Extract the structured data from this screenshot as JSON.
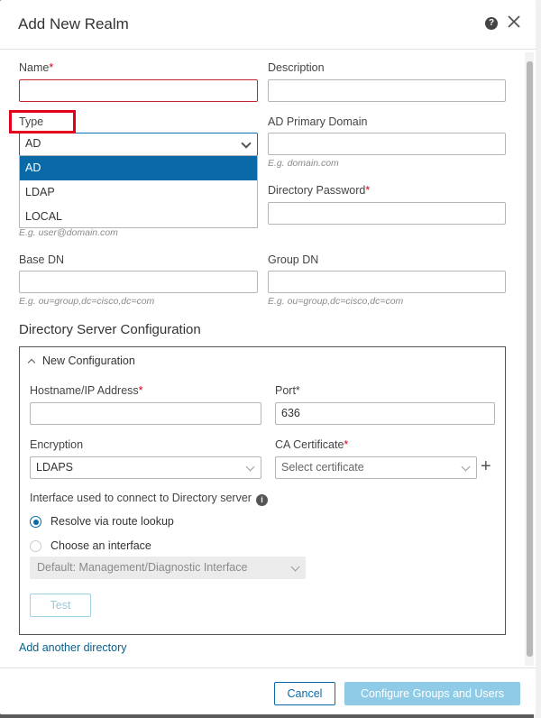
{
  "dialog": {
    "title": "Add New Realm",
    "help_icon": "?"
  },
  "fields": {
    "name_label": "Name",
    "name_required": "*",
    "name_value": "",
    "description_label": "Description",
    "description_value": "",
    "type_label": "Type",
    "type_value": "AD",
    "ad_domain_label": "AD Primary Domain",
    "ad_domain_hint": "E.g. domain.com",
    "dir_username_hint": "E.g. user@domain.com",
    "dir_password_label": "Directory Password",
    "dir_password_required": "*",
    "base_dn_label": "Base DN",
    "base_dn_hint": "E.g. ou=group,dc=cisco,dc=com",
    "group_dn_label": "Group DN",
    "group_dn_hint": "E.g. ou=group,dc=cisco,dc=com"
  },
  "type_options": [
    {
      "label": "AD",
      "selected": true
    },
    {
      "label": "LDAP",
      "selected": false
    },
    {
      "label": "LOCAL",
      "selected": false
    }
  ],
  "directory": {
    "section_title": "Directory Server Configuration",
    "config_header": "New Configuration",
    "hostname_label": "Hostname/IP Address",
    "hostname_required": "*",
    "port_label": "Port*",
    "port_value": "636",
    "encryption_label": "Encryption",
    "encryption_value": "LDAPS",
    "ca_label": "CA Certificate",
    "ca_required": "*",
    "ca_placeholder": "Select certificate",
    "interface_label": "Interface used to connect to Directory server",
    "radio_route": "Resolve via route lookup",
    "radio_choose": "Choose an interface",
    "interface_select": "Default: Management/Diagnostic Interface",
    "test_button": "Test"
  },
  "add_directory_link": "Add another directory",
  "footer": {
    "cancel": "Cancel",
    "submit": "Configure Groups and Users"
  },
  "colors": {
    "accent": "#0a6aa8",
    "error": "#d0021b",
    "highlight": "#e3001b"
  }
}
